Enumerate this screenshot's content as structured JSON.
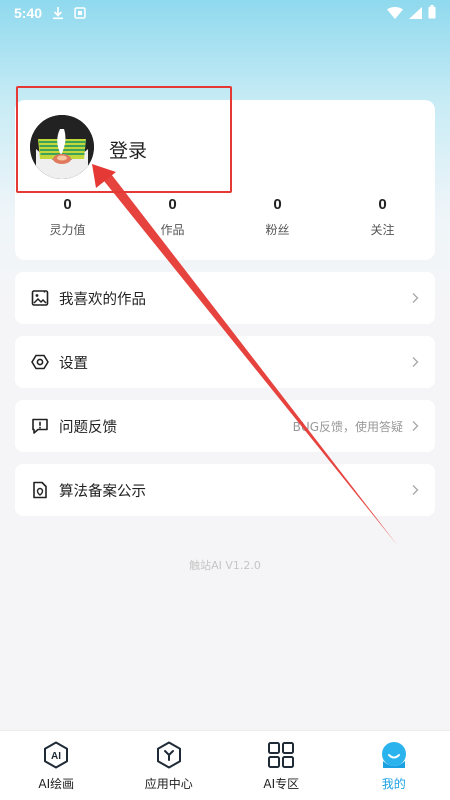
{
  "status_bar": {
    "time": "5:40"
  },
  "profile": {
    "login_label": "登录"
  },
  "stats": [
    {
      "value": "0",
      "label": "灵力值"
    },
    {
      "value": "0",
      "label": "作品"
    },
    {
      "value": "0",
      "label": "粉丝"
    },
    {
      "value": "0",
      "label": "关注"
    }
  ],
  "menu": [
    {
      "label": "我喜欢的作品",
      "hint": ""
    },
    {
      "label": "设置",
      "hint": ""
    },
    {
      "label": "问题反馈",
      "hint": "BUG反馈，使用答疑"
    },
    {
      "label": "算法备案公示",
      "hint": ""
    }
  ],
  "version": "触站AI V1.2.0",
  "tabbar": [
    {
      "label": "AI绘画",
      "icon": "ai-paint-icon"
    },
    {
      "label": "应用中心",
      "icon": "app-center-icon"
    },
    {
      "label": "AI专区",
      "icon": "grid-icon"
    },
    {
      "label": "我的",
      "icon": "profile-face-icon",
      "active": true
    }
  ],
  "colors": {
    "accent": "#1ba1e2",
    "annotation": "#e53935"
  }
}
